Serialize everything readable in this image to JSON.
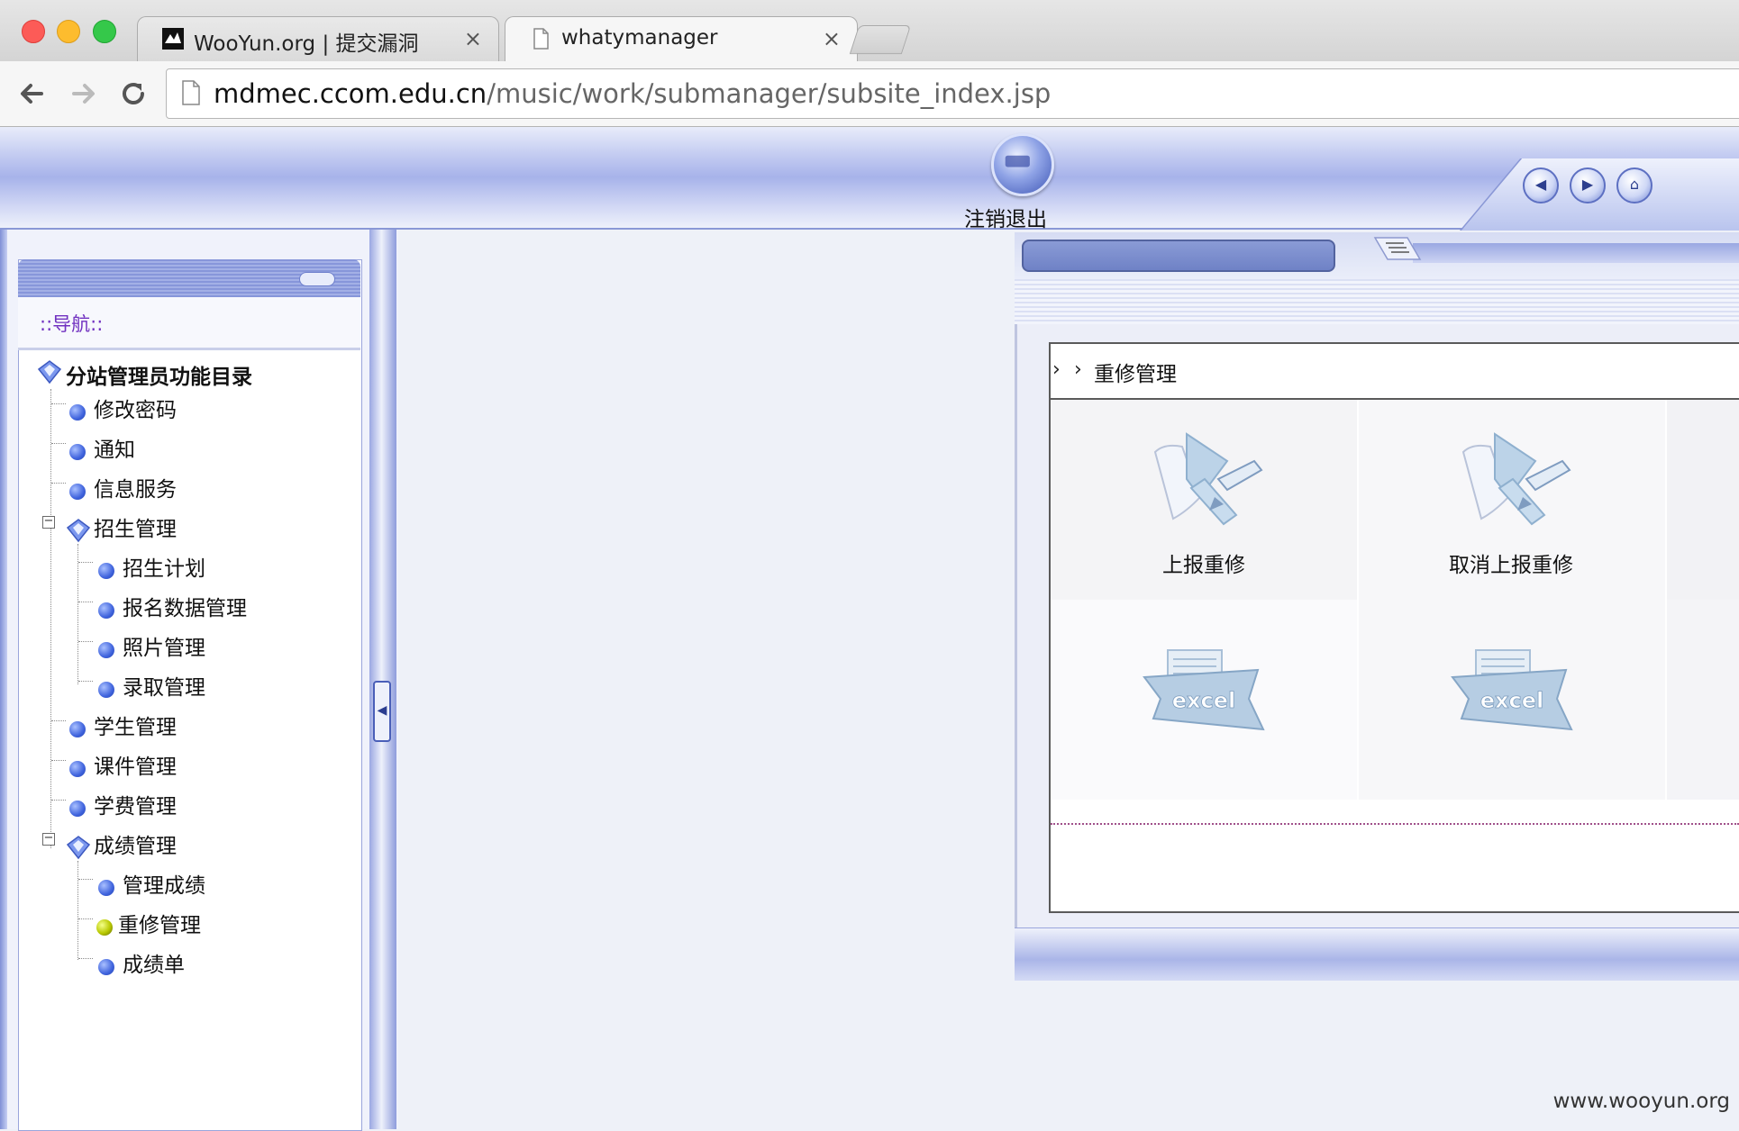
{
  "browser": {
    "tabs": [
      {
        "title": "WooYun.org | 提交漏洞",
        "close": "×",
        "active": false
      },
      {
        "title": "whatymanager",
        "close": "×",
        "active": true
      }
    ],
    "url_host": "mdmec.ccom.edu.cn",
    "url_path": "/music/work/submanager/subsite_index.jsp"
  },
  "header": {
    "logout_label": "注销退出"
  },
  "sidebar": {
    "nav_label": "::导航::",
    "root_label": "分站管理员功能目录",
    "items": [
      {
        "label": "修改密码"
      },
      {
        "label": "通知"
      },
      {
        "label": "信息服务"
      },
      {
        "label": "招生管理",
        "children": [
          {
            "label": "招生计划"
          },
          {
            "label": "报名数据管理"
          },
          {
            "label": "照片管理"
          },
          {
            "label": "录取管理"
          }
        ]
      },
      {
        "label": "学生管理"
      },
      {
        "label": "课件管理"
      },
      {
        "label": "学费管理"
      },
      {
        "label": "成绩管理",
        "children": [
          {
            "label": "管理成绩"
          },
          {
            "label": "重修管理",
            "selected": true
          },
          {
            "label": "成绩单"
          }
        ]
      }
    ],
    "toggle_glyph": "−"
  },
  "main": {
    "section_title": "重修管理",
    "chevrons": [
      "›",
      "›"
    ],
    "actions": [
      {
        "label": "上报重修",
        "icon": "edit-report-icon"
      },
      {
        "label": "取消上报重修",
        "icon": "edit-report-icon"
      },
      {
        "label": "",
        "icon": "excel-export-icon",
        "icon_text": "excel"
      },
      {
        "label": "",
        "icon": "excel-export-icon",
        "icon_text": "excel"
      }
    ]
  },
  "watermark": "www.wooyun.org",
  "colors": {
    "accent": "#7f8fd8",
    "selected_dot": "#b8c800",
    "nav_label": "#7030c0"
  }
}
